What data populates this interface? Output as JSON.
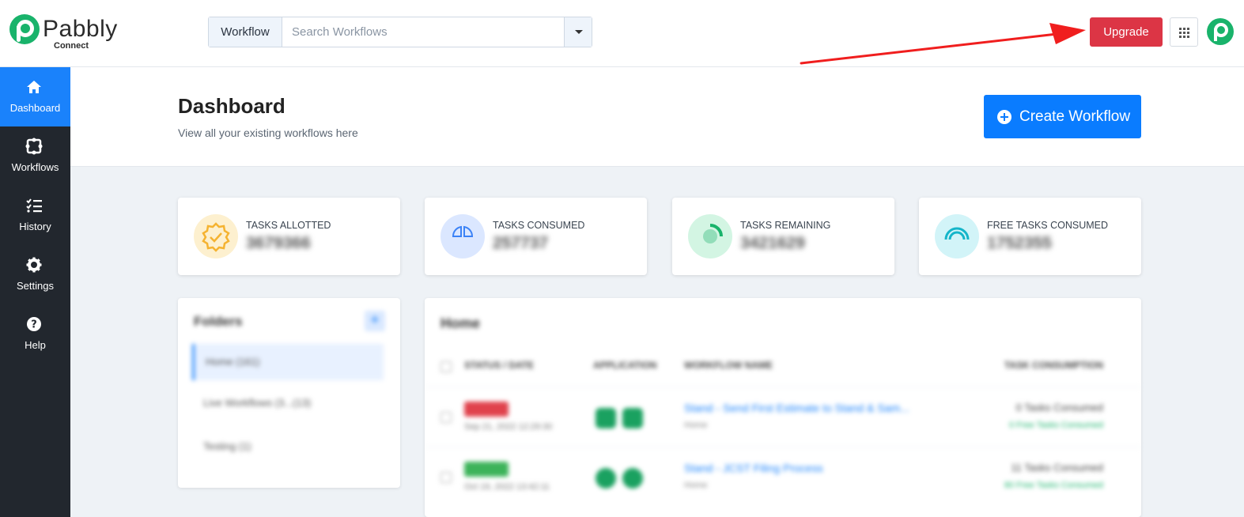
{
  "brand": {
    "name": "Pabbly",
    "sub": "Connect"
  },
  "search": {
    "scope_label": "Workflow",
    "placeholder": "Search Workflows"
  },
  "header": {
    "upgrade_label": "Upgrade"
  },
  "sidebar": {
    "items": [
      {
        "label": "Dashboard",
        "icon": "home-icon",
        "active": true
      },
      {
        "label": "Workflows",
        "icon": "puzzle-icon"
      },
      {
        "label": "History",
        "icon": "checklist-icon"
      },
      {
        "label": "Settings",
        "icon": "gear-icon"
      },
      {
        "label": "Help",
        "icon": "question-icon"
      }
    ]
  },
  "page": {
    "title": "Dashboard",
    "subtitle": "View all your existing workflows here",
    "create_label": "Create Workflow"
  },
  "stats": [
    {
      "label": "TASKS ALLOTTED",
      "value": "3679366",
      "color": "#f5b331"
    },
    {
      "label": "TASKS CONSUMED",
      "value": "257737",
      "color": "#3b82f6"
    },
    {
      "label": "TASKS REMAINING",
      "value": "3421629",
      "color": "#19b36b"
    },
    {
      "label": "FREE TASKS CONSUMED",
      "value": "1752355",
      "color": "#15b5c9"
    }
  ],
  "folders": {
    "title": "Folders",
    "items": [
      {
        "label": "Home (161)"
      },
      {
        "label": "Live Workflows (3...(13)"
      },
      {
        "label": "Testing (1)"
      }
    ]
  },
  "workflows": {
    "title": "Home",
    "columns": {
      "status": "STATUS / DATE",
      "app": "APPLICATION",
      "name": "WORKFLOW NAME",
      "tasks": "TASK CONSUMPTION"
    },
    "rows": [
      {
        "date": "Sep 21, 2022 12:29:30",
        "name": "Stand - Send First Estimate to Stand & Sam...",
        "sub": "Home",
        "consumed": "0 Tasks Consumed",
        "free": "0 Free Tasks Consumed",
        "status_color": "#e0424c"
      },
      {
        "date": "Oct 19, 2022 13:42:11",
        "name": "Stand - JCST Filing Process",
        "sub": "Home",
        "consumed": "11 Tasks Consumed",
        "free": "80 Free Tasks Consumed",
        "status_color": "#3cb35a"
      }
    ]
  }
}
